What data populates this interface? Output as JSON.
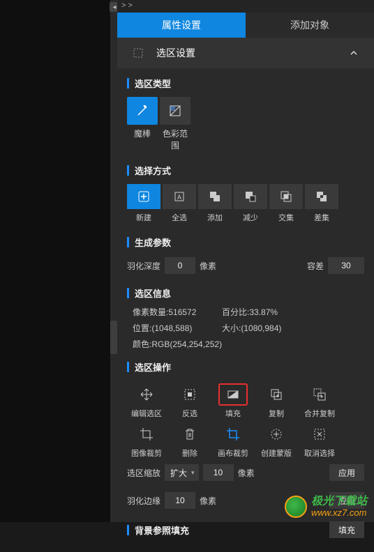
{
  "breadcrumb": "> >",
  "tabs": {
    "props": "属性设置",
    "add": "添加对象"
  },
  "section": {
    "title": "选区设置"
  },
  "selType": {
    "title": "选区类型",
    "wand": "魔棒",
    "colorRange": "色彩范围"
  },
  "selMode": {
    "title": "选择方式",
    "new": "新建",
    "all": "全选",
    "add": "添加",
    "sub": "减少",
    "inter": "交集",
    "diff": "差集"
  },
  "genParams": {
    "title": "生成参数",
    "featherLabel": "羽化深度",
    "featherVal": "0",
    "pxUnit": "像素",
    "tolLabel": "容差",
    "tolVal": "30"
  },
  "info": {
    "title": "选区信息",
    "pxCountLabel": "像素数量:",
    "pxCountVal": "516572",
    "pctLabel": "百分比:",
    "pctVal": "33.87%",
    "posLabel": "位置:",
    "posVal": "(1048,588)",
    "sizeLabel": "大小:",
    "sizeVal": "(1080,984)",
    "colorLabel": "颜色:",
    "colorVal": "RGB(254,254,252)"
  },
  "ops": {
    "title": "选区操作",
    "edit": "编辑选区",
    "invert": "反选",
    "fill": "填充",
    "copy": "复制",
    "mergeCopy": "合并复制",
    "cropImg": "图像裁剪",
    "delete": "删除",
    "cropCanvas": "画布裁剪",
    "mask": "创建蒙版",
    "deselect": "取消选择",
    "scaleLabel": "选区缩放",
    "scaleMode": "扩大",
    "scaleVal": "10",
    "pxUnit": "像素",
    "featherLabel": "羽化边缘",
    "featherVal": "10",
    "apply": "应用"
  },
  "bgFill": {
    "title": "背景参照填充",
    "btn": "填充"
  },
  "watermark": {
    "name": "极光下载站",
    "url": "www.xz7.com"
  }
}
